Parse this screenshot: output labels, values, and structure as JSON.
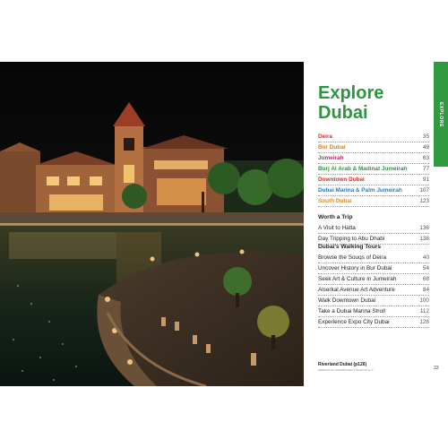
{
  "side_tab": {
    "label": "EXPLORE"
  },
  "heading": {
    "line1": "Explore",
    "line2": "Dubai",
    "color": "#2e9541"
  },
  "areas": [
    {
      "label": "Deira",
      "page": "35",
      "color": "#d2332a",
      "weight": "bold"
    },
    {
      "label": "Bur Dubai",
      "page": "49",
      "color": "#e07a1c",
      "weight": "bold"
    },
    {
      "label": "Jumeirah",
      "page": "63",
      "color": "#c4267c",
      "weight": "bold"
    },
    {
      "label": "Burj Al Arab & Madinat Jumeirah",
      "page": "77",
      "color": "#2e9541",
      "weight": "bold"
    },
    {
      "label": "Downtown Dubai",
      "page": "91",
      "color": "#d2332a",
      "weight": "bold"
    },
    {
      "label": "Dubai Marina & Palm Jumeirah",
      "page": "107",
      "color": "#2a7fb8",
      "weight": "bold"
    },
    {
      "label": "South Dubai",
      "page": "123",
      "color": "#e8891b",
      "weight": "bold"
    }
  ],
  "worth_a_trip": {
    "title": "Worth a Trip",
    "items": [
      {
        "label": "A Visit to Hatta",
        "page": "136"
      },
      {
        "label": "Day Tripping to Abu Dhabi",
        "page": "138"
      }
    ]
  },
  "walking_tours": {
    "title": "Dubai's Walking Tours",
    "items": [
      {
        "label": "Browse the Souqs of Deira",
        "page": "40"
      },
      {
        "label": "Uncover History in Bur Dubai",
        "page": "54"
      },
      {
        "label": "Seek Art & Culture in Jumeirah",
        "page": "68"
      },
      {
        "label": "Alserkal Avenue Art Adventure",
        "page": "84"
      },
      {
        "label": "Walk Downtown Dubai",
        "page": "100"
      },
      {
        "label": "Take a Dubai Marina Stroll",
        "page": "112"
      },
      {
        "label": "Experience Expo City Dubai",
        "page": "128"
      }
    ]
  },
  "caption": {
    "title": "Riverland Dubai (p126)",
    "credit": "SEBASTIAN HORNBY/SHUTTERSTOCK ©"
  },
  "page_number": "33",
  "colors": {
    "tab_green": "#2f9a3e",
    "night_sky": "#0b0b0d",
    "lagoon": "#1b2a1c"
  }
}
